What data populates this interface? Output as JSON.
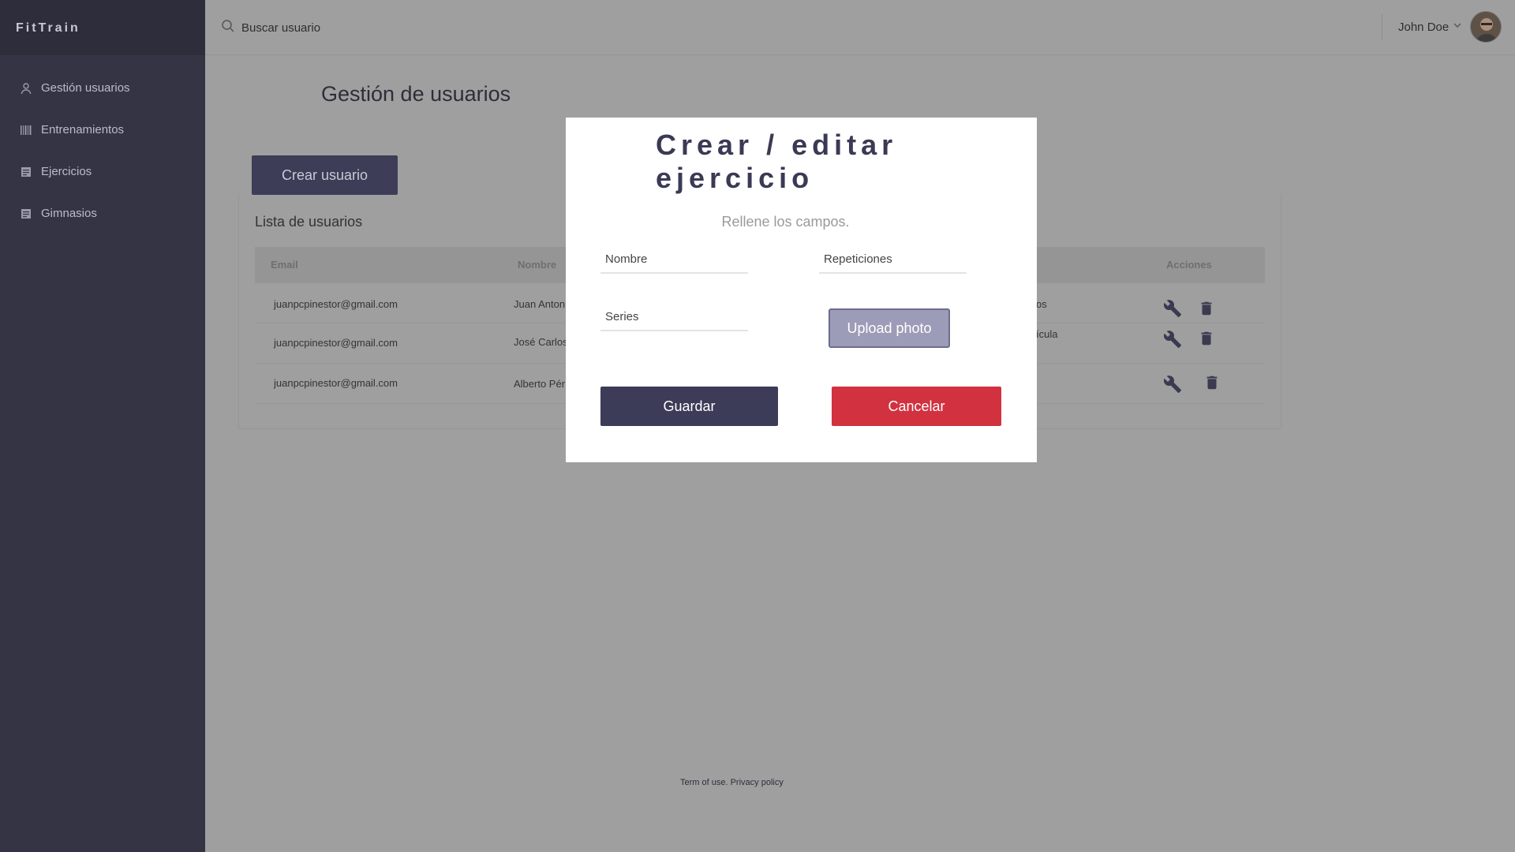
{
  "sidebar": {
    "brand": "FitTrain",
    "items": [
      {
        "label": "Gestión usuarios",
        "icon": "user-icon"
      },
      {
        "label": "Entrenamientos",
        "icon": "barcode-icon"
      },
      {
        "label": "Ejercicios",
        "icon": "list-icon"
      },
      {
        "label": "Gimnasios",
        "icon": "list-icon"
      }
    ]
  },
  "topbar": {
    "search_placeholder": "Buscar usuario",
    "user_name": "John Doe"
  },
  "main": {
    "title": "Gestión de usuarios",
    "create_button": "Crear usuario",
    "list_title": "Lista de usuarios",
    "columns": [
      "Email",
      "Nombre",
      "Acciones"
    ],
    "rows": [
      {
        "email": "juanpcpinestor@gmail.com",
        "name": "Juan Anton",
        "extra": "os"
      },
      {
        "email": "juanpcpinestor@gmail.com",
        "name": "José Carlos",
        "extra": "ícula"
      },
      {
        "email": "juanpcpinestor@gmail.com",
        "name": "Alberto Pér",
        "extra": ""
      }
    ]
  },
  "footer": {
    "terms": "Term of use.",
    "privacy": "Privacy policy"
  },
  "modal": {
    "title": "Crear / editar ejercicio",
    "subtitle": "Rellene los campos.",
    "fields": {
      "nombre": "Nombre",
      "repeticiones": "Repeticiones",
      "series": "Series"
    },
    "upload_label": "Upload photo",
    "save_label": "Guardar",
    "cancel_label": "Cancelar"
  },
  "colors": {
    "sidebar": "#343444",
    "overlay": "#9f9f9f",
    "primary": "#3c3c58",
    "danger": "#d23240",
    "upload": "#9c9cb8"
  }
}
